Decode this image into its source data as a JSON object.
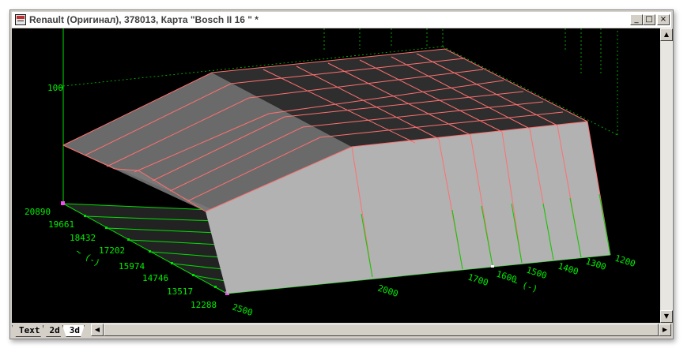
{
  "window": {
    "title": "Renault (Оригинал), 378013, Карта \"Bosch II 16 \" *",
    "buttons": {
      "minimize": "_",
      "maximize": "□",
      "close": "×"
    }
  },
  "plot": {
    "z_tick": "100",
    "left_axis_ticks": [
      "20890",
      "19661",
      "18432",
      "17202",
      "15974",
      "14746",
      "13517",
      "12288"
    ],
    "left_axis_label": "~ (-)",
    "right_axis_ticks": [
      "2500",
      "2000",
      "1700",
      "1600",
      "1500",
      "1400",
      "1300",
      "1200"
    ],
    "right_axis_label": "~ (-)",
    "colors": {
      "grid": "#00e000",
      "surface_line": "#ff6f6f",
      "surface_light": "#b2b2b2",
      "surface_mid": "#6a6a6a",
      "surface_dark": "#2e2e2e"
    }
  },
  "tabs": [
    "Text",
    "2d",
    "3d"
  ],
  "active_tab": "3d",
  "scroll": {
    "up": "▲",
    "down": "▼",
    "left": "◀",
    "right": "▶"
  }
}
